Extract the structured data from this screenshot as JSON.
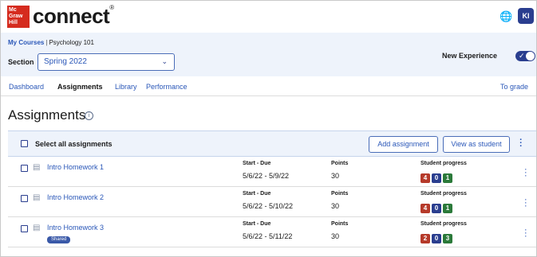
{
  "logo": {
    "line1": "Mc",
    "line2": "Graw",
    "line3": "Hill",
    "brand": "connect",
    "tm": "®"
  },
  "user": {
    "initials": "KI"
  },
  "breadcrumb": {
    "link": "My Courses",
    "separator": "|",
    "current": "Psychology 101"
  },
  "section": {
    "label": "Section",
    "value": "Spring 2022"
  },
  "new_experience": {
    "label": "New Experience",
    "enabled": true
  },
  "nav": {
    "items": [
      {
        "label": "Dashboard",
        "active": false
      },
      {
        "label": "Assignments",
        "active": true
      },
      {
        "label": "Library",
        "active": false
      },
      {
        "label": "Performance",
        "active": false
      }
    ],
    "to_grade": "To grade"
  },
  "page": {
    "title": "Assignments",
    "info_glyph": "i"
  },
  "table": {
    "select_all": "Select all assignments",
    "add_button": "Add assignment",
    "view_button": "View as student",
    "col_start": "Start - Due",
    "col_points": "Points",
    "col_progress": "Student progress",
    "rows": [
      {
        "name": "Intro Homework 1",
        "dates": "5/6/22 - 5/9/22",
        "points": "30",
        "progress": [
          "4",
          "0",
          "1"
        ],
        "shared": ""
      },
      {
        "name": "Intro Homework 2",
        "dates": "5/6/22 - 5/10/22",
        "points": "30",
        "progress": [
          "4",
          "0",
          "1"
        ],
        "shared": ""
      },
      {
        "name": "Intro Homework 3",
        "dates": "5/6/22 - 5/11/22",
        "points": "30",
        "progress": [
          "2",
          "0",
          "3"
        ],
        "shared": "Shared"
      }
    ]
  },
  "colors": {
    "brand_red": "#d52b1e",
    "accent_blue": "#2a57b8",
    "navy": "#2a3e8f",
    "badge_red": "#b63a2a",
    "badge_green": "#2b7a3a"
  }
}
